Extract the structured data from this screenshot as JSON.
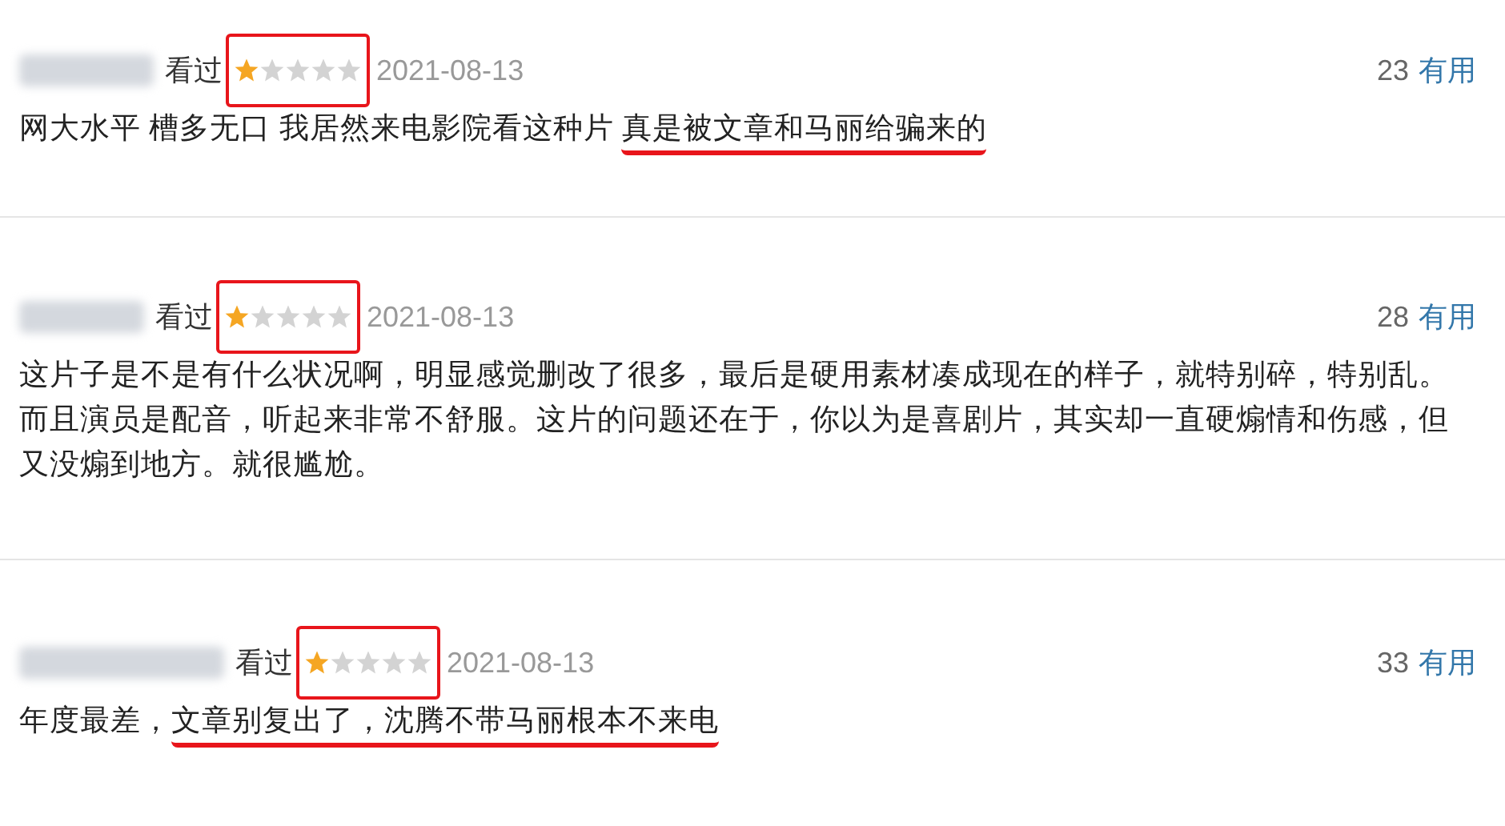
{
  "reviews": [
    {
      "status": "看过",
      "rating": {
        "stars": 1,
        "highlighted": true
      },
      "date": "2021-08-13",
      "useful_count": "23",
      "useful_label": "有用",
      "lines": [
        [
          {
            "text": "网大水平 槽多无口 我居然来电影院看这种片 ",
            "underlined": false
          },
          {
            "text": "真是被文章和马丽给骗来的",
            "underlined": true
          }
        ]
      ]
    },
    {
      "status": "看过",
      "rating": {
        "stars": 1,
        "highlighted": true
      },
      "date": "2021-08-13",
      "useful_count": "28",
      "useful_label": "有用",
      "lines": [
        [
          {
            "text": "这片子是不是有什么状况啊，明显感觉删改了很多，最后是硬用素材凑成现在的样子，就特别碎，特别乱。",
            "underlined": false
          }
        ],
        [
          {
            "text": "而且演员是配音，听起来非常不舒服。这片的问题还在于，你以为是喜剧片，其实却一直硬煽情和伤感，但",
            "underlined": false
          }
        ],
        [
          {
            "text": "又没煽到地方。就很尴尬。",
            "underlined": false
          }
        ]
      ]
    },
    {
      "status": "看过",
      "rating": {
        "stars": 1,
        "highlighted": true
      },
      "date": "2021-08-13",
      "useful_count": "33",
      "useful_label": "有用",
      "lines": [
        [
          {
            "text": "年度最差，",
            "underlined": false
          },
          {
            "text": "文章别复出了，沈腾不带马丽根本不来电",
            "underlined": true
          }
        ]
      ]
    }
  ]
}
